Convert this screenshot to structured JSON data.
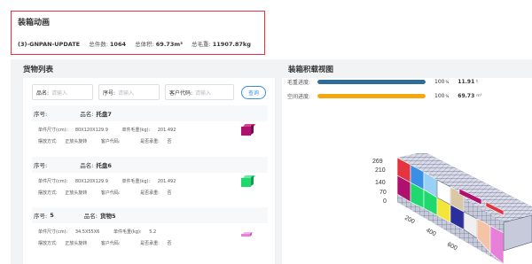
{
  "animation": {
    "title": "装箱动画",
    "plan_name": "(3)-GNPAN-UPDATE",
    "total_pieces_label": "总件数:",
    "total_pieces": "1064",
    "total_volume_label": "总体积:",
    "total_volume": "69.73m³",
    "total_weight_label": "总毛重:",
    "total_weight": "11907.87kg"
  },
  "goods_list": {
    "title": "货物列表",
    "search": {
      "name_label": "品名:",
      "name_placeholder": "请输入",
      "serial_label": "序号:",
      "serial_placeholder": "请输入",
      "customer_label": "客户代码:",
      "customer_placeholder": "请输入",
      "search_button": "查询"
    },
    "labels": {
      "serial": "序号:",
      "name": "品名:",
      "unit_size": "单件尺寸(cm):",
      "unit_weight": "单件毛重(kg):",
      "placement": "摆放方式:",
      "customer_code": "客户代码:",
      "stackable": "是否承重:"
    },
    "items": [
      {
        "serial": "",
        "name": "托盘7",
        "unit_size": "80X120X129.9",
        "unit_weight": "201.492",
        "placement": "正放头旋转",
        "customer_code": "",
        "stackable": "否",
        "color": "#b0116f",
        "side_color": "#7a0b4e",
        "top_color": "#d1488f"
      },
      {
        "serial": "",
        "name": "托盘6",
        "unit_size": "80X120X129.9",
        "unit_weight": "201.492",
        "placement": "正放头旋转",
        "customer_code": "",
        "stackable": "否",
        "color": "#1fd86e",
        "side_color": "#13a050",
        "top_color": "#6be89f"
      },
      {
        "serial": "5",
        "name": "货物5",
        "unit_size": "34.5X55X6",
        "unit_weight": "5.2",
        "placement": "正放头旋转",
        "customer_code": "",
        "stackable": "否",
        "color": "#e87fd8",
        "side_color": "#c45bb5",
        "top_color": "#f3b2ea"
      }
    ]
  },
  "loading_view": {
    "title": "装箱积载视图",
    "weight_progress": {
      "label": "毛重进度:",
      "percent": "100",
      "percent_unit": "%",
      "amount": "11.91",
      "amount_unit": "t",
      "fill": 1.0,
      "color": "#2f6d99"
    },
    "volume_progress": {
      "label": "空间进度:",
      "percent": "100",
      "percent_unit": "%",
      "amount": "69.73",
      "amount_unit": "m³",
      "fill": 1.0,
      "color": "#f5a70f"
    },
    "axis_labels": [
      "269",
      "210",
      "140",
      "70",
      "0",
      "200",
      "400",
      "600"
    ]
  }
}
